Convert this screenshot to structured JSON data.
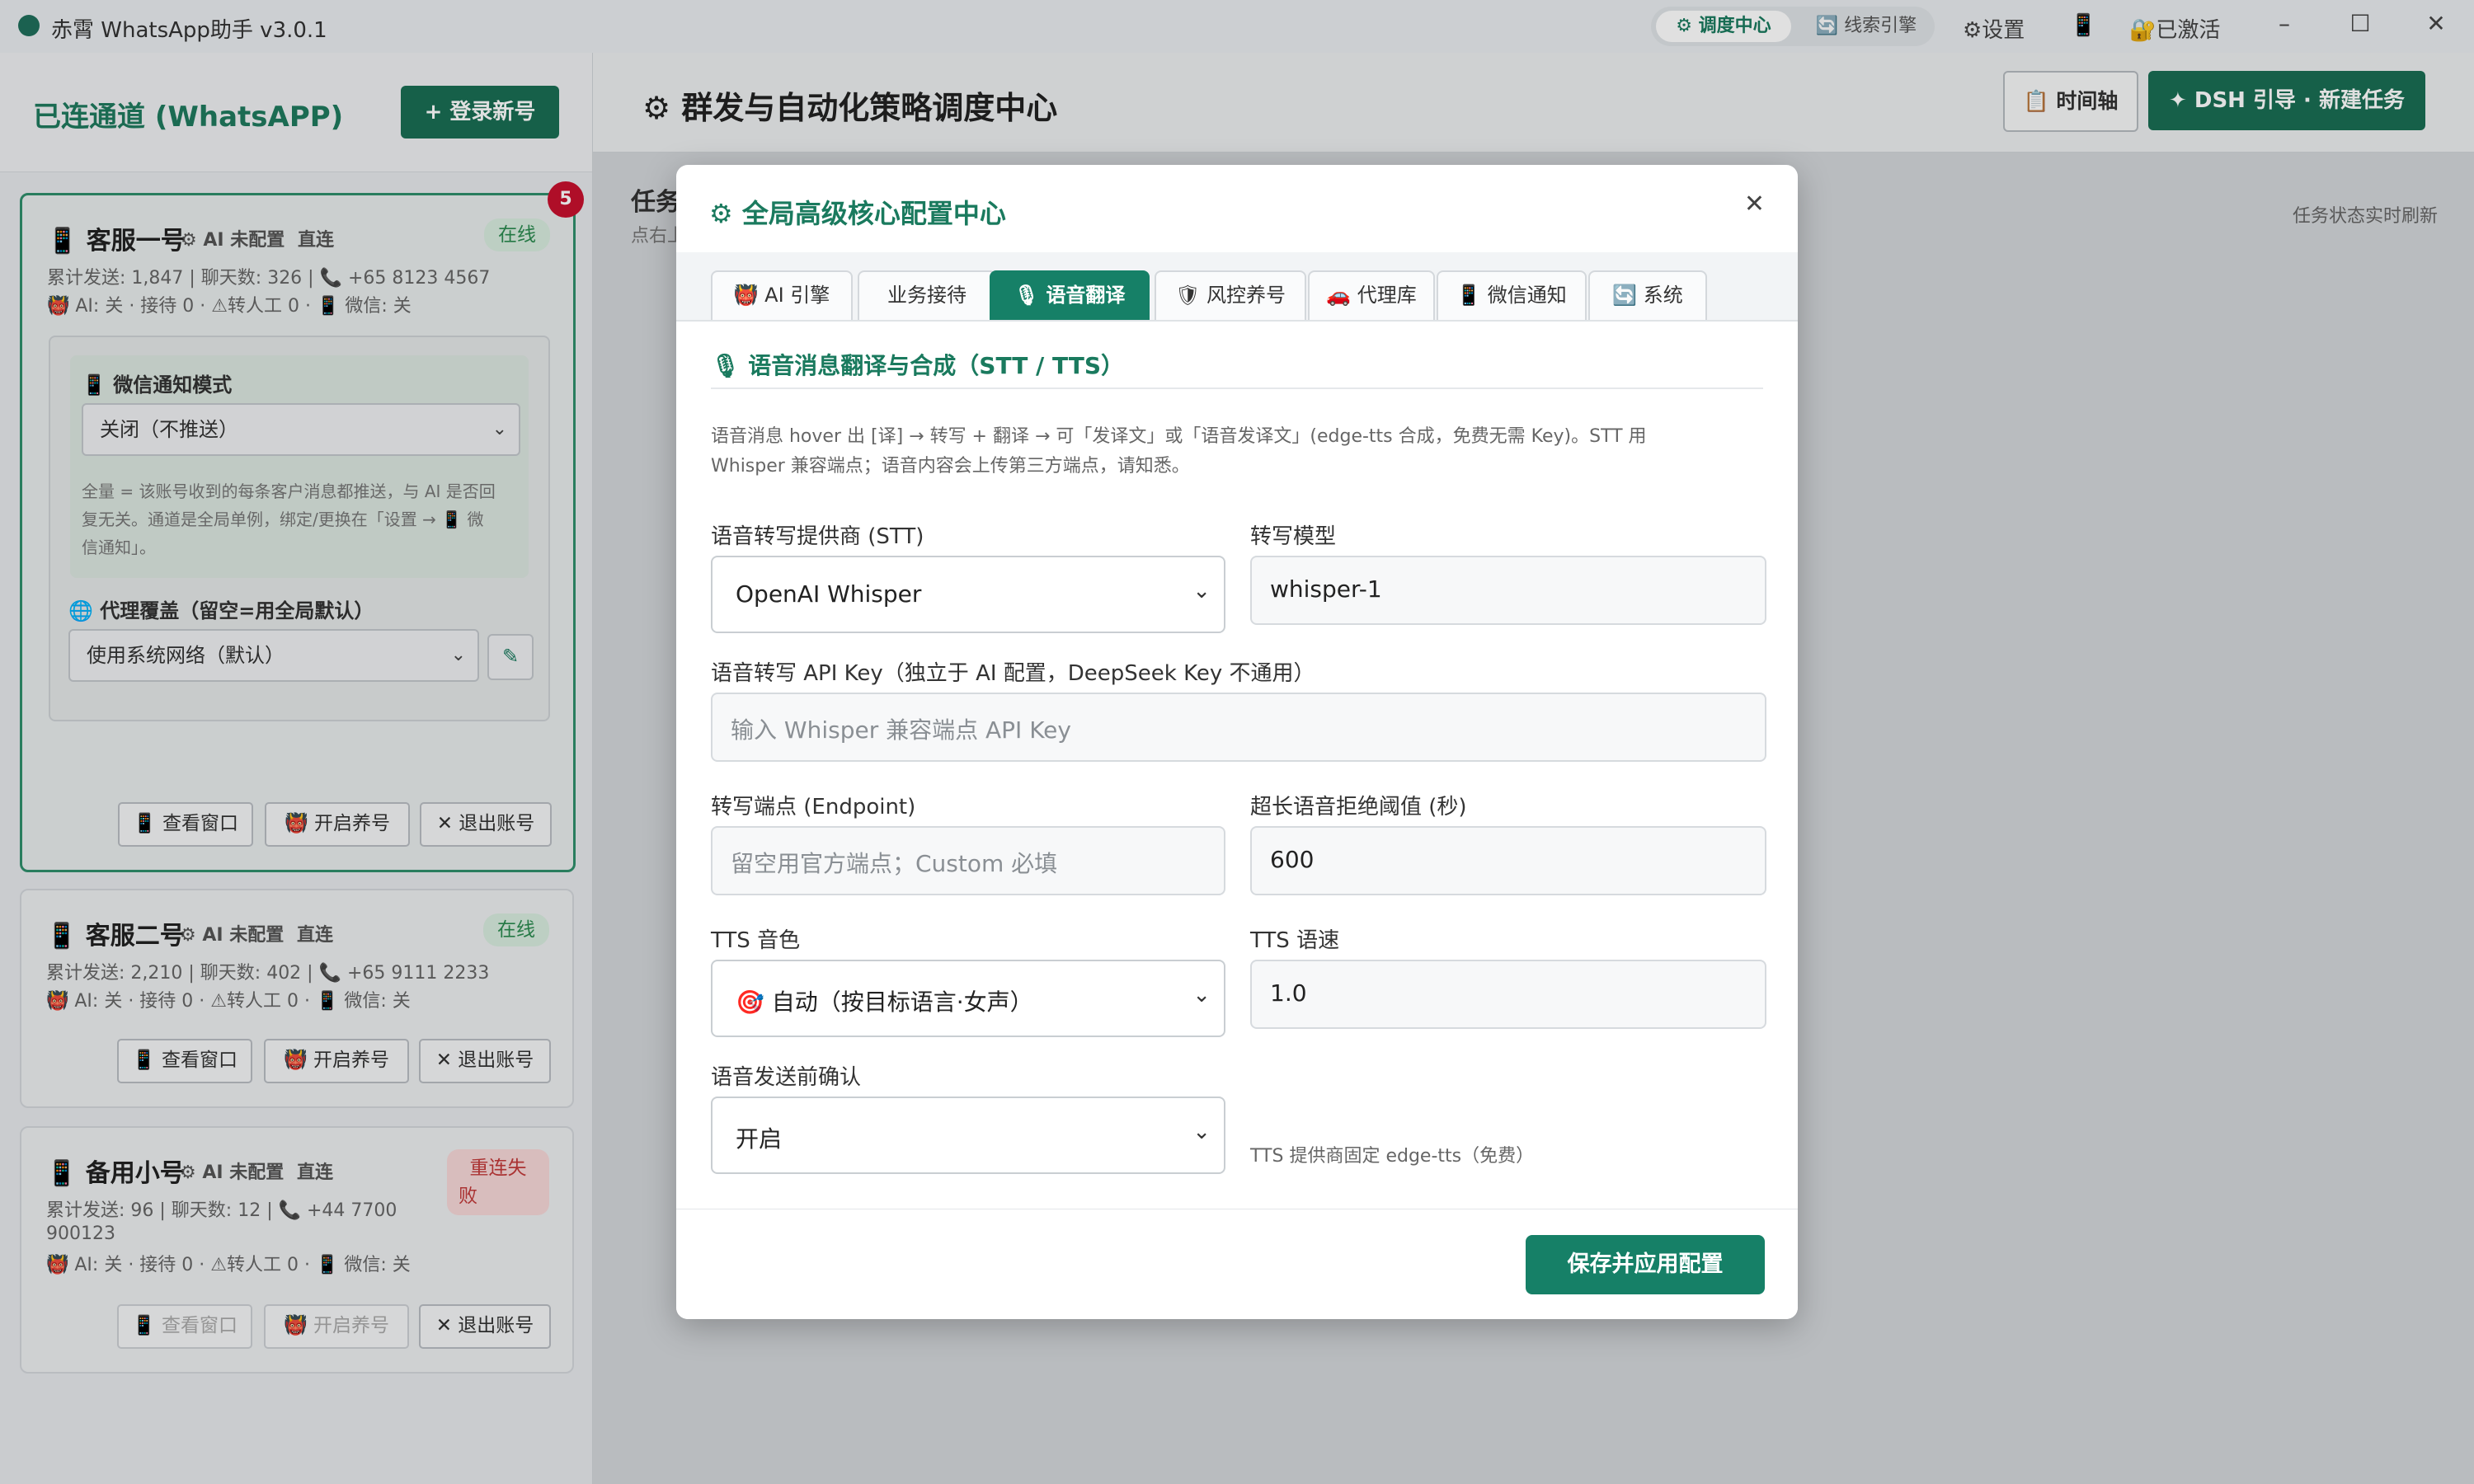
{
  "window": {
    "title": "赤霄 WhatsApp助手 v3.0.1",
    "seg_active": "⚙ 调度中心",
    "seg_other": "🔄 线索引擎",
    "settings": "⚙设置",
    "phone_icon": "📱",
    "activated": "🔐已激活",
    "minimize": "–",
    "maximize": "☐",
    "close": "✕"
  },
  "sidebar": {
    "title": "已连通道 (WhatsAPP)",
    "login_button": "+ 登录新号",
    "cards": [
      {
        "name": "📱 客服一号",
        "ai": "⚙ AI 未配置",
        "route": "直连",
        "status": "在线",
        "badge_count": "5",
        "stats": "累计发送: 1,847 | 聊天数: 326 | 📞 +65 8123 4567",
        "ai_line": "👹 AI: 关 · 接待 0 · ⚠转人工 0 · 📱 微信: 关",
        "notify_label": "📱 微信通知模式",
        "notify_value": "关闭（不推送）",
        "notify_desc_1": "全量 = 该账号收到的每条客户消息都推送，与 AI 是否回",
        "notify_desc_2": "复无关。通道是全局单例，绑定/更换在「设置 → 📱 微",
        "notify_desc_3": "信通知」。",
        "proxy_label": "🌐 代理覆盖（留空=用全局默认）",
        "proxy_value": "使用系统网络（默认）",
        "btn_view": "📱 查看窗口",
        "btn_nurture": "👹 开启养号",
        "btn_logout": "✕ 退出账号"
      },
      {
        "name": "📱 客服二号",
        "ai": "⚙ AI 未配置",
        "route": "直连",
        "status": "在线",
        "stats": "累计发送: 2,210 | 聊天数: 402 | 📞 +65 9111 2233",
        "ai_line": "👹 AI: 关 · 接待 0 · ⚠转人工 0 · 📱 微信: 关",
        "btn_view": "📱 查看窗口",
        "btn_nurture": "👹 开启养号",
        "btn_logout": "✕ 退出账号"
      },
      {
        "name": "📱 备用小号",
        "ai": "⚙ AI 未配置",
        "route": "直连",
        "status_1": "重连失",
        "status_2": "败",
        "stats_1": "累计发送: 96 | 聊天数: 12 | 📞 +44 7700",
        "stats_2": "900123",
        "ai_line": "👹 AI: 关 · 接待 0 · ⚠转人工 0 · 📱 微信: 关",
        "btn_view": "📱 查看窗口",
        "btn_nurture": "👹 开启养号",
        "btn_logout": "✕ 退出账号"
      }
    ]
  },
  "main": {
    "title": "⚙ 群发与自动化策略调度中心",
    "timeline_button": "📋 时间轴",
    "new_task_button": "✦ DSH 引导 · 新建任务",
    "task_title": "任务",
    "task_sub": "点右上",
    "task_right": "任务状态实时刷新"
  },
  "modal": {
    "title": "⚙ 全局高级核心配置中心",
    "close": "✕",
    "tabs": [
      "👹 AI 引擎",
      "业务接待",
      "🎙 语音翻译",
      "🛡 风控养号",
      "🚗 代理库",
      "📱 微信通知",
      "🔄 系统"
    ],
    "section_title": "🎙 语音消息翻译与合成（STT / TTS）",
    "desc_1": "语音消息 hover 出 [译] → 转写 + 翻译 → 可「发译文」或「语音发译文」(edge-tts 合成，免费无需 Key)。STT 用",
    "desc_2": "Whisper 兼容端点；语音内容会上传第三方端点，请知悉。",
    "stt_provider_label": "语音转写提供商 (STT)",
    "stt_provider_value": "OpenAI Whisper",
    "model_label": "转写模型",
    "model_value": "whisper-1",
    "api_key_label": "语音转写 API Key（独立于 AI 配置，DeepSeek Key 不通用）",
    "api_key_placeholder": "输入 Whisper 兼容端点 API Key",
    "endpoint_label": "转写端点 (Endpoint)",
    "endpoint_placeholder": "留空用官方端点；Custom 必填",
    "threshold_label": "超长语音拒绝阈值 (秒)",
    "threshold_value": "600",
    "tts_voice_label": "TTS 音色",
    "tts_voice_value": "🎯 自动（按目标语言·女声）",
    "tts_speed_label": "TTS 语速",
    "tts_speed_value": "1.0",
    "confirm_label": "语音发送前确认",
    "confirm_value": "开启",
    "tts_hint": "TTS 提供商固定 edge-tts（免费）",
    "save_button": "保存并应用配置"
  },
  "colors": {
    "accent": "#168067",
    "accent_text": "#1a7a5e",
    "danger": "#c8102e"
  }
}
